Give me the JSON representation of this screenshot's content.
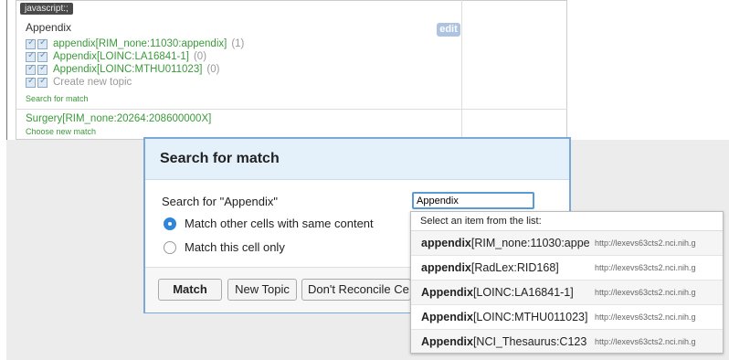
{
  "background": {
    "tooltip": "javascript:;",
    "tooltip_tail": "",
    "cell_title": "Appendix",
    "edit_label": "edit",
    "rows": [
      {
        "label": "appendix[RIM_none:11030:appendix]",
        "count": "(1)",
        "grey": false
      },
      {
        "label": "Appendix[LOINC:LA16841-1]",
        "count": "(0)",
        "grey": false
      },
      {
        "label": "Appendix[LOINC:MTHU011023]",
        "count": "(0)",
        "grey": false
      },
      {
        "label": "Create new topic",
        "count": "",
        "grey": true
      }
    ],
    "search_link": "Search for match",
    "surgery_label": "Surgery[RIM_none:20264:208600000X]",
    "choose_link": "Choose new match"
  },
  "dialog": {
    "title": "Search for match",
    "prompt": "Search for \"Appendix\"",
    "search_value": "Appendix",
    "radio_same": "Match other cells with same content",
    "radio_only": "Match this cell only",
    "btn_match": "Match",
    "btn_new_topic": "New Topic",
    "btn_dont_reconcile": "Don't Reconcile Ce"
  },
  "autocomplete": {
    "header": "Select an item from the list:",
    "items": [
      {
        "bold": "appendix",
        "rest": "[RIM_none:11030:appe",
        "url": "http://lexevs63cts2.nci.nih.g"
      },
      {
        "bold": "appendix",
        "rest": "[RadLex:RID168]",
        "url": "http://lexevs63cts2.nci.nih.g"
      },
      {
        "bold": "Appendix",
        "rest": "[LOINC:LA16841-1]",
        "url": "http://lexevs63cts2.nci.nih.g"
      },
      {
        "bold": "Appendix",
        "rest": "[LOINC:MTHU011023]",
        "url": "http://lexevs63cts2.nci.nih.g"
      },
      {
        "bold": "Appendix",
        "rest": "[NCI_Thesaurus:C123",
        "url": "http://lexevs63cts2.nci.nih.g"
      }
    ]
  },
  "colors": {
    "accent": "#2f86d9",
    "match_green": "#3a9a3a",
    "dialog_header": "#e4f0fa"
  }
}
